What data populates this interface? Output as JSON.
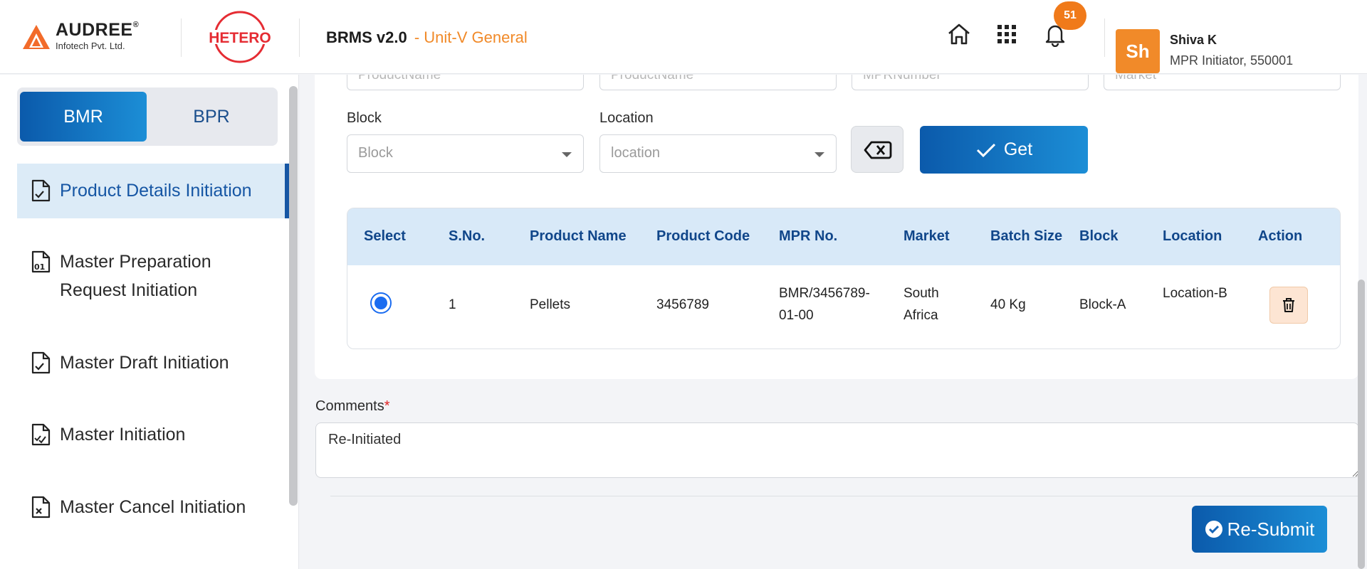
{
  "header": {
    "brand_name": "AUDREE",
    "brand_reg": "®",
    "brand_sub": "Infotech Pvt. Ltd.",
    "partner_logo": "HETERO",
    "app_title": "BRMS v2.0",
    "app_unit": "- Unit-V General",
    "icons": [
      "home-icon",
      "apps-grid-icon",
      "bell-icon"
    ],
    "notification_count": "51",
    "user": {
      "avatar_initials": "Sh",
      "name": "Shiva K",
      "role": "MPR Initiator, 550001"
    },
    "colors": {
      "accent": "#f18a29",
      "primary": "#1656a4"
    }
  },
  "sidebar": {
    "toggle": {
      "bmr": "BMR",
      "bpr": "BPR",
      "selected": "BMR"
    },
    "items": [
      {
        "label": "Product Details Initiation",
        "icon": "file-check-icon",
        "active": true
      },
      {
        "label": "Master Preparation Request Initiation",
        "icon": "file-binary-icon",
        "active": false
      },
      {
        "label": "Master Draft Initiation",
        "icon": "file-check-icon",
        "active": false
      },
      {
        "label": "Master Initiation",
        "icon": "file-double-check-icon",
        "active": false
      },
      {
        "label": "Master Cancel Initiation",
        "icon": "file-x-icon",
        "active": false
      }
    ]
  },
  "filters": {
    "partial_placeholders": [
      "ProductName",
      "ProductName",
      "MPRNumber",
      "Market"
    ],
    "block": {
      "label": "Block",
      "placeholder": "Block"
    },
    "location": {
      "label": "Location",
      "placeholder": "location"
    },
    "get_label": "Get"
  },
  "table": {
    "headers": [
      "Select",
      "S.No.",
      "Product Name",
      "Product Code",
      "MPR No.",
      "Market",
      "Batch Size",
      "Block",
      "Location",
      "Action"
    ],
    "rows": [
      {
        "selected": true,
        "sno": "1",
        "product_name": "Pellets",
        "product_code": "3456789",
        "mpr_no": "BMR/3456789-01-00",
        "market": "South Africa",
        "batch_size": "40 Kg",
        "block": "Block-A",
        "location": "Location-B"
      }
    ]
  },
  "comments": {
    "label": "Comments",
    "required_mark": "*",
    "value": "Re-Initiated"
  },
  "resubmit_label": "Re-Submit"
}
